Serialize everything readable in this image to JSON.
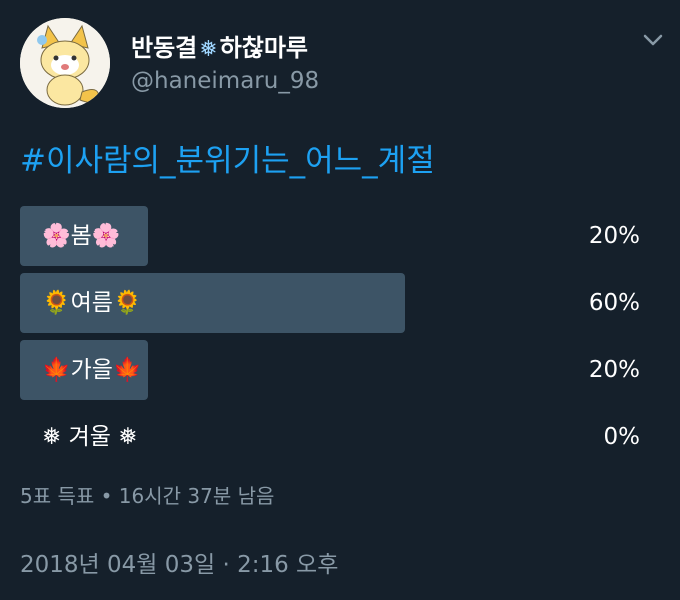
{
  "author": {
    "display_name_part1": "반동결",
    "name_emoji": "❅",
    "display_name_part2": "하찮마루",
    "handle": "@haneimaru_98"
  },
  "tweet": {
    "hashtag": "#이사람의_분위기는_어느_계절"
  },
  "poll": {
    "options": [
      {
        "label": "🌸봄🌸",
        "percent_text": "20%",
        "percent": 20
      },
      {
        "label": "🌻여름🌻",
        "percent_text": "60%",
        "percent": 60
      },
      {
        "label": "🍁가을🍁",
        "percent_text": "20%",
        "percent": 20
      },
      {
        "label": "❅ 겨울 ❅",
        "percent_text": "0%",
        "percent": 0
      }
    ],
    "meta": "5표 득표 • 16시간 37분 남음"
  },
  "timestamp": "2018년 04월 03일 · 2:16 오후",
  "colors": {
    "background": "#15202b",
    "hashtag": "#1da1f2",
    "bar": "#3d5466",
    "muted": "#8899a6"
  },
  "icons": {
    "caret": "chevron-down-icon",
    "avatar": "fox-avatar"
  }
}
